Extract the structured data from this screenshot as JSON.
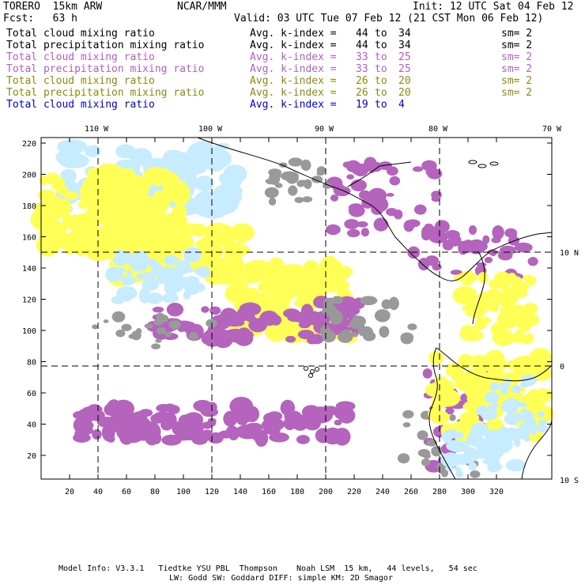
{
  "header": {
    "title_left": "TORERO  15km ARW",
    "center": "NCAR/MMM",
    "init": "Init: 12 UTC Sat 04 Feb 12",
    "fcst": "Fcst:   63 h",
    "valid": "Valid: 03 UTC Tue 07 Feb 12 (21 CST Mon 06 Feb 12)"
  },
  "legend": [
    {
      "label": "Total cloud mixing ratio",
      "kindex": "Avg. k-index =",
      "a": "44",
      "to": "to",
      "b": "34",
      "sm": "sm= 2",
      "color": "#000000"
    },
    {
      "label": "Total precipitation mixing ratio",
      "kindex": "Avg. k-index =",
      "a": "44",
      "to": "to",
      "b": "34",
      "sm": "sm= 2",
      "color": "#000000"
    },
    {
      "label": "Total cloud mixing ratio",
      "kindex": "Avg. k-index =",
      "a": "33",
      "to": "to",
      "b": "25",
      "sm": "sm= 2",
      "color": "#b060c0"
    },
    {
      "label": "Total precipitation mixing ratio",
      "kindex": "Avg. k-index =",
      "a": "33",
      "to": "to",
      "b": "25",
      "sm": "sm= 2",
      "color": "#b060c0"
    },
    {
      "label": "Total cloud mixing ratio",
      "kindex": "Avg. k-index =",
      "a": "26",
      "to": "to",
      "b": "20",
      "sm": "sm= 2",
      "color": "#8a8a10"
    },
    {
      "label": "Total precipitation mixing ratio",
      "kindex": "Avg. k-index =",
      "a": "26",
      "to": "to",
      "b": "20",
      "sm": "sm= 2",
      "color": "#8a8a10"
    },
    {
      "label": "Total cloud mixing ratio",
      "kindex": "Avg. k-index =",
      "a": "19",
      "to": "to",
      "b": "4",
      "sm": "",
      "color": "#0000d0"
    }
  ],
  "map": {
    "lon_labels": [
      "110 W",
      "100 W",
      "90 W",
      "80 W",
      "70 W"
    ],
    "lat_labels": [
      "10 N",
      "0",
      "10 S"
    ],
    "x_ticks": [
      "20",
      "40",
      "60",
      "80",
      "100",
      "120",
      "140",
      "160",
      "180",
      "200",
      "220",
      "240",
      "260",
      "280",
      "300",
      "320"
    ],
    "y_ticks": [
      "220",
      "200",
      "180",
      "160",
      "140",
      "120",
      "100",
      "80",
      "60",
      "40",
      "20"
    ],
    "colors": {
      "gray": "#999999",
      "purple": "#b464bc",
      "yellow": "#ffff55",
      "lightblue": "#c8ecff",
      "palegreen": "#f4f4c8"
    }
  },
  "footer": {
    "line1": "Model Info: V3.3.1   Tiedtke YSU PBL  Thompson    Noah LSM  15 km,   44 levels,   54 sec",
    "line2": "LW: Godd SW: Goddard DIFF: simple KM: 2D Smagor"
  }
}
